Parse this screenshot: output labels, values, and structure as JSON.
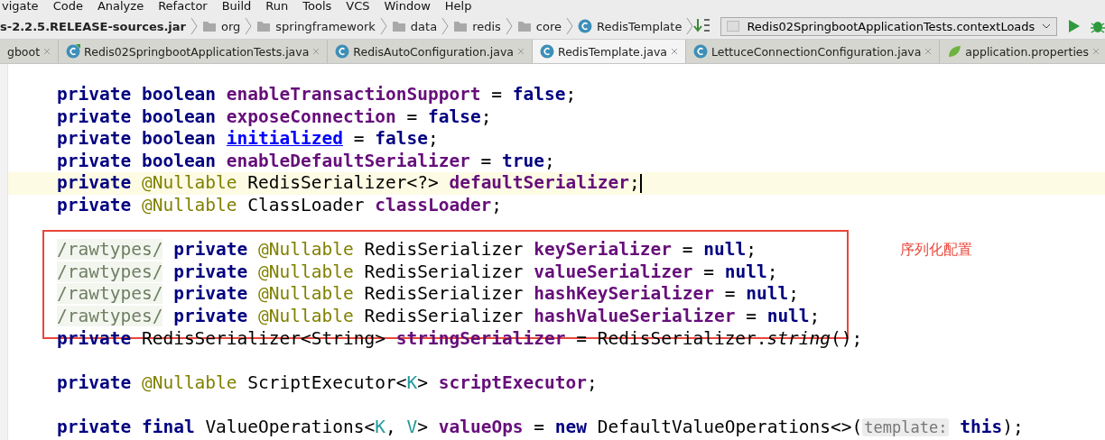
{
  "menu": [
    "vigate",
    "Code",
    "Analyze",
    "Refactor",
    "Build",
    "Run",
    "Tools",
    "VCS",
    "Window",
    "Help"
  ],
  "breadcrumb": [
    {
      "label": "s-2.2.5.RELEASE-sources.jar",
      "kind": "jar"
    },
    {
      "label": "org",
      "kind": "folder"
    },
    {
      "label": "springframework",
      "kind": "folder"
    },
    {
      "label": "data",
      "kind": "folder"
    },
    {
      "label": "redis",
      "kind": "folder"
    },
    {
      "label": "core",
      "kind": "folder"
    },
    {
      "label": "RedisTemplate",
      "kind": "class"
    }
  ],
  "run_config": {
    "label": "Redis02SpringbootApplicationTests.contextLoads"
  },
  "tabs": [
    {
      "label": "gboot",
      "kind": "plain",
      "selected": false
    },
    {
      "label": "Redis02SpringbootApplicationTests.java",
      "kind": "test",
      "selected": false
    },
    {
      "label": "RedisAutoConfiguration.java",
      "kind": "class",
      "selected": false
    },
    {
      "label": "RedisTemplate.java",
      "kind": "class",
      "selected": true
    },
    {
      "label": "LettuceConnectionConfiguration.java",
      "kind": "class",
      "selected": false
    },
    {
      "label": "application.properties",
      "kind": "spring",
      "selected": false
    }
  ],
  "code_sections": [
    {
      "boxed": false,
      "lines": [
        {
          "kind": "code",
          "current": false,
          "tokens": [
            {
              "t": "private boolean ",
              "kind": "kw"
            },
            {
              "t": "enableTransactionSupport",
              "kind": "field"
            },
            {
              "t": " = ",
              "kind": "p"
            },
            {
              "t": "false",
              "kind": "kw"
            },
            {
              "t": ";",
              "kind": "p"
            }
          ]
        },
        {
          "kind": "code",
          "current": false,
          "tokens": [
            {
              "t": "private boolean ",
              "kind": "kw"
            },
            {
              "t": "exposeConnection",
              "kind": "field"
            },
            {
              "t": " = ",
              "kind": "p"
            },
            {
              "t": "false",
              "kind": "kw"
            },
            {
              "t": ";",
              "kind": "p"
            }
          ]
        },
        {
          "kind": "code",
          "current": false,
          "tokens": [
            {
              "t": "private boolean ",
              "kind": "kw"
            },
            {
              "t": "initialized",
              "kind": "link"
            },
            {
              "t": " = ",
              "kind": "p"
            },
            {
              "t": "false",
              "kind": "kw"
            },
            {
              "t": ";",
              "kind": "p"
            }
          ]
        },
        {
          "kind": "code",
          "current": false,
          "tokens": [
            {
              "t": "private boolean ",
              "kind": "kw"
            },
            {
              "t": "enableDefaultSerializer",
              "kind": "field"
            },
            {
              "t": " = ",
              "kind": "p"
            },
            {
              "t": "true",
              "kind": "kw"
            },
            {
              "t": ";",
              "kind": "p"
            }
          ]
        },
        {
          "kind": "code",
          "current": true,
          "tokens": [
            {
              "t": "private ",
              "kind": "kw"
            },
            {
              "t": "@Nullable",
              "kind": "ann"
            },
            {
              "t": " RedisSerializer<?> ",
              "kind": "p"
            },
            {
              "t": "defaultSerializer",
              "kind": "field"
            },
            {
              "t": ";",
              "kind": "p"
            }
          ]
        },
        {
          "kind": "code",
          "current": false,
          "tokens": [
            {
              "t": "private ",
              "kind": "kw"
            },
            {
              "t": "@Nullable",
              "kind": "ann"
            },
            {
              "t": " ClassLoader ",
              "kind": "p"
            },
            {
              "t": "classLoader",
              "kind": "field"
            },
            {
              "t": ";",
              "kind": "p"
            }
          ]
        },
        {
          "kind": "blank",
          "current": false
        }
      ]
    },
    {
      "boxed": true,
      "lines": [
        {
          "kind": "code",
          "current": false,
          "tokens": [
            {
              "t": "/rawtypes/",
              "kind": "cm"
            },
            {
              "t": " private ",
              "kind": "kw"
            },
            {
              "t": "@Nullable",
              "kind": "ann"
            },
            {
              "t": " RedisSerializer ",
              "kind": "p"
            },
            {
              "t": "keySerializer",
              "kind": "field"
            },
            {
              "t": " = ",
              "kind": "p"
            },
            {
              "t": "null",
              "kind": "kw"
            },
            {
              "t": ";",
              "kind": "p"
            }
          ]
        },
        {
          "kind": "code",
          "current": false,
          "tokens": [
            {
              "t": "/rawtypes/",
              "kind": "cm"
            },
            {
              "t": " private ",
              "kind": "kw"
            },
            {
              "t": "@Nullable",
              "kind": "ann"
            },
            {
              "t": " RedisSerializer ",
              "kind": "p"
            },
            {
              "t": "valueSerializer",
              "kind": "field"
            },
            {
              "t": " = ",
              "kind": "p"
            },
            {
              "t": "null",
              "kind": "kw"
            },
            {
              "t": ";",
              "kind": "p"
            }
          ]
        },
        {
          "kind": "code",
          "current": false,
          "tokens": [
            {
              "t": "/rawtypes/",
              "kind": "cm"
            },
            {
              "t": " private ",
              "kind": "kw"
            },
            {
              "t": "@Nullable",
              "kind": "ann"
            },
            {
              "t": " RedisSerializer ",
              "kind": "p"
            },
            {
              "t": "hashKeySerializer",
              "kind": "field"
            },
            {
              "t": " = ",
              "kind": "p"
            },
            {
              "t": "null",
              "kind": "kw"
            },
            {
              "t": ";",
              "kind": "p"
            }
          ]
        },
        {
          "kind": "code",
          "current": false,
          "tokens": [
            {
              "t": "/rawtypes/",
              "kind": "cm"
            },
            {
              "t": " private ",
              "kind": "kw"
            },
            {
              "t": "@Nullable",
              "kind": "ann"
            },
            {
              "t": " RedisSerializer ",
              "kind": "p"
            },
            {
              "t": "hashValueSerializer",
              "kind": "field"
            },
            {
              "t": " = ",
              "kind": "p"
            },
            {
              "t": "null",
              "kind": "kw"
            },
            {
              "t": ";",
              "kind": "p"
            }
          ]
        }
      ]
    },
    {
      "boxed": false,
      "lines": [
        {
          "kind": "code",
          "current": false,
          "tokens": [
            {
              "t": "private ",
              "kind": "kw"
            },
            {
              "t": "RedisSerializer<String> ",
              "kind": "p"
            },
            {
              "t": "stringSerializer",
              "kind": "field"
            },
            {
              "t": " = RedisSerializer.",
              "kind": "p"
            },
            {
              "t": "string",
              "kind": "ital"
            },
            {
              "t": "();",
              "kind": "p"
            }
          ]
        },
        {
          "kind": "blank",
          "current": false
        },
        {
          "kind": "code",
          "current": false,
          "tokens": [
            {
              "t": "private ",
              "kind": "kw"
            },
            {
              "t": "@Nullable",
              "kind": "ann"
            },
            {
              "t": " ScriptExecutor<",
              "kind": "p"
            },
            {
              "t": "K",
              "kind": "gen"
            },
            {
              "t": "> ",
              "kind": "p"
            },
            {
              "t": "scriptExecutor",
              "kind": "field"
            },
            {
              "t": ";",
              "kind": "p"
            }
          ]
        },
        {
          "kind": "blank",
          "current": false
        },
        {
          "kind": "code",
          "current": false,
          "tokens": [
            {
              "t": "private final ",
              "kind": "kw"
            },
            {
              "t": "ValueOperations<",
              "kind": "p"
            },
            {
              "t": "K",
              "kind": "gen"
            },
            {
              "t": ", ",
              "kind": "p"
            },
            {
              "t": "V",
              "kind": "gen"
            },
            {
              "t": "> ",
              "kind": "p"
            },
            {
              "t": "valueOps",
              "kind": "field"
            },
            {
              "t": " = ",
              "kind": "p"
            },
            {
              "t": "new ",
              "kind": "kw"
            },
            {
              "t": "DefaultValueOperations<>(",
              "kind": "p"
            },
            {
              "t": "template:",
              "kind": "hint"
            },
            {
              "t": " this",
              "kind": "kw"
            },
            {
              "t": ");",
              "kind": "p"
            }
          ]
        }
      ]
    }
  ],
  "annotation": {
    "label": "序列化配置"
  }
}
